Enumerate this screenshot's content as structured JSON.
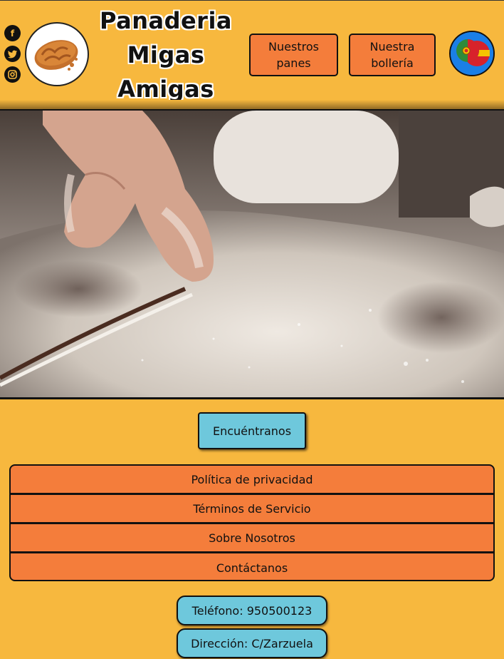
{
  "header": {
    "title_line1": "Panaderia",
    "title_line2": "Migas",
    "title_line3": "Amigas",
    "social": [
      {
        "icon": "facebook-icon",
        "glyph": "f"
      },
      {
        "icon": "twitter-icon",
        "glyph": "t"
      },
      {
        "icon": "instagram-icon",
        "glyph": "◎"
      }
    ],
    "nav": {
      "panes_line1": "Nuestros",
      "panes_line2": "panes",
      "bolleria_line1": "Nuestra",
      "bolleria_line2": "bollería"
    },
    "language_icon": "flags-portugal-spain-icon"
  },
  "hero": {
    "image_icon": "hands-flour-dough-image"
  },
  "find_button": "Encuéntranos",
  "footer_links": [
    "Política de privacidad",
    "Términos de Servicio",
    "Sobre Nosotros",
    "Contáctanos"
  ],
  "contact": {
    "phone": "Teléfono: 950500123",
    "address": "Dirección: C/Zarzuela"
  },
  "colors": {
    "background": "#f7b83e",
    "orange": "#f47d3b",
    "cyan": "#6ec8dc"
  }
}
